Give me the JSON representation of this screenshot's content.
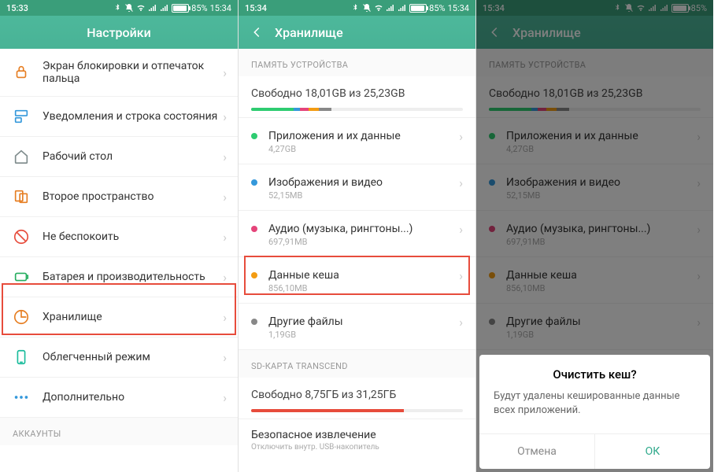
{
  "statusBars": [
    {
      "time": "15:33",
      "batt": "85%",
      "battTime": "15:34"
    },
    {
      "time": "15:34",
      "batt": "85%",
      "battTime": "15:34"
    },
    {
      "time": "15:34",
      "batt": "85%",
      "battTime": ""
    }
  ],
  "settings": {
    "title": "Настройки",
    "items": [
      {
        "label": "Экран блокировки и отпечаток пальца"
      },
      {
        "label": "Уведомления и строка состояния"
      },
      {
        "label": "Рабочий стол"
      },
      {
        "label": "Второе пространство"
      },
      {
        "label": "Не беспокоить"
      },
      {
        "label": "Батарея и производительность"
      },
      {
        "label": "Хранилище"
      },
      {
        "label": "Облегченный режим"
      },
      {
        "label": "Дополнительно"
      }
    ],
    "accounts": "АККАУНТЫ"
  },
  "storage": {
    "title": "Хранилище",
    "deviceMem": "ПАМЯТЬ УСТРОЙСТВА",
    "freeText": "Свободно 18,01GB из 25,23GB",
    "cats": [
      {
        "label": "Приложения и их данные",
        "size": "4,27GB",
        "color": "#2ecc71"
      },
      {
        "label": "Изображения и видео",
        "size": "52,15MB",
        "color": "#3498db"
      },
      {
        "label": "Аудио (музыка, рингтоны...)",
        "size": "697,91MB",
        "color": "#e5447a"
      },
      {
        "label": "Данные кеша",
        "size": "856,10MB",
        "color": "#f39c12"
      },
      {
        "label": "Другие файлы",
        "size": "1,19GB",
        "color": "#888"
      }
    ],
    "sdLabel": "SD-КАРТА TRANSCEND",
    "sdFree": "Свободно 8,75ГБ из 31,25ГБ",
    "safeEject": "Безопасное извлечение",
    "safeSub": "Отключить внутр. USB-накопитель"
  },
  "dialog": {
    "title": "Очистить кеш?",
    "body": "Будут удалены кешированные данные всех приложений.",
    "cancel": "Отмена",
    "ok": "ОК"
  }
}
